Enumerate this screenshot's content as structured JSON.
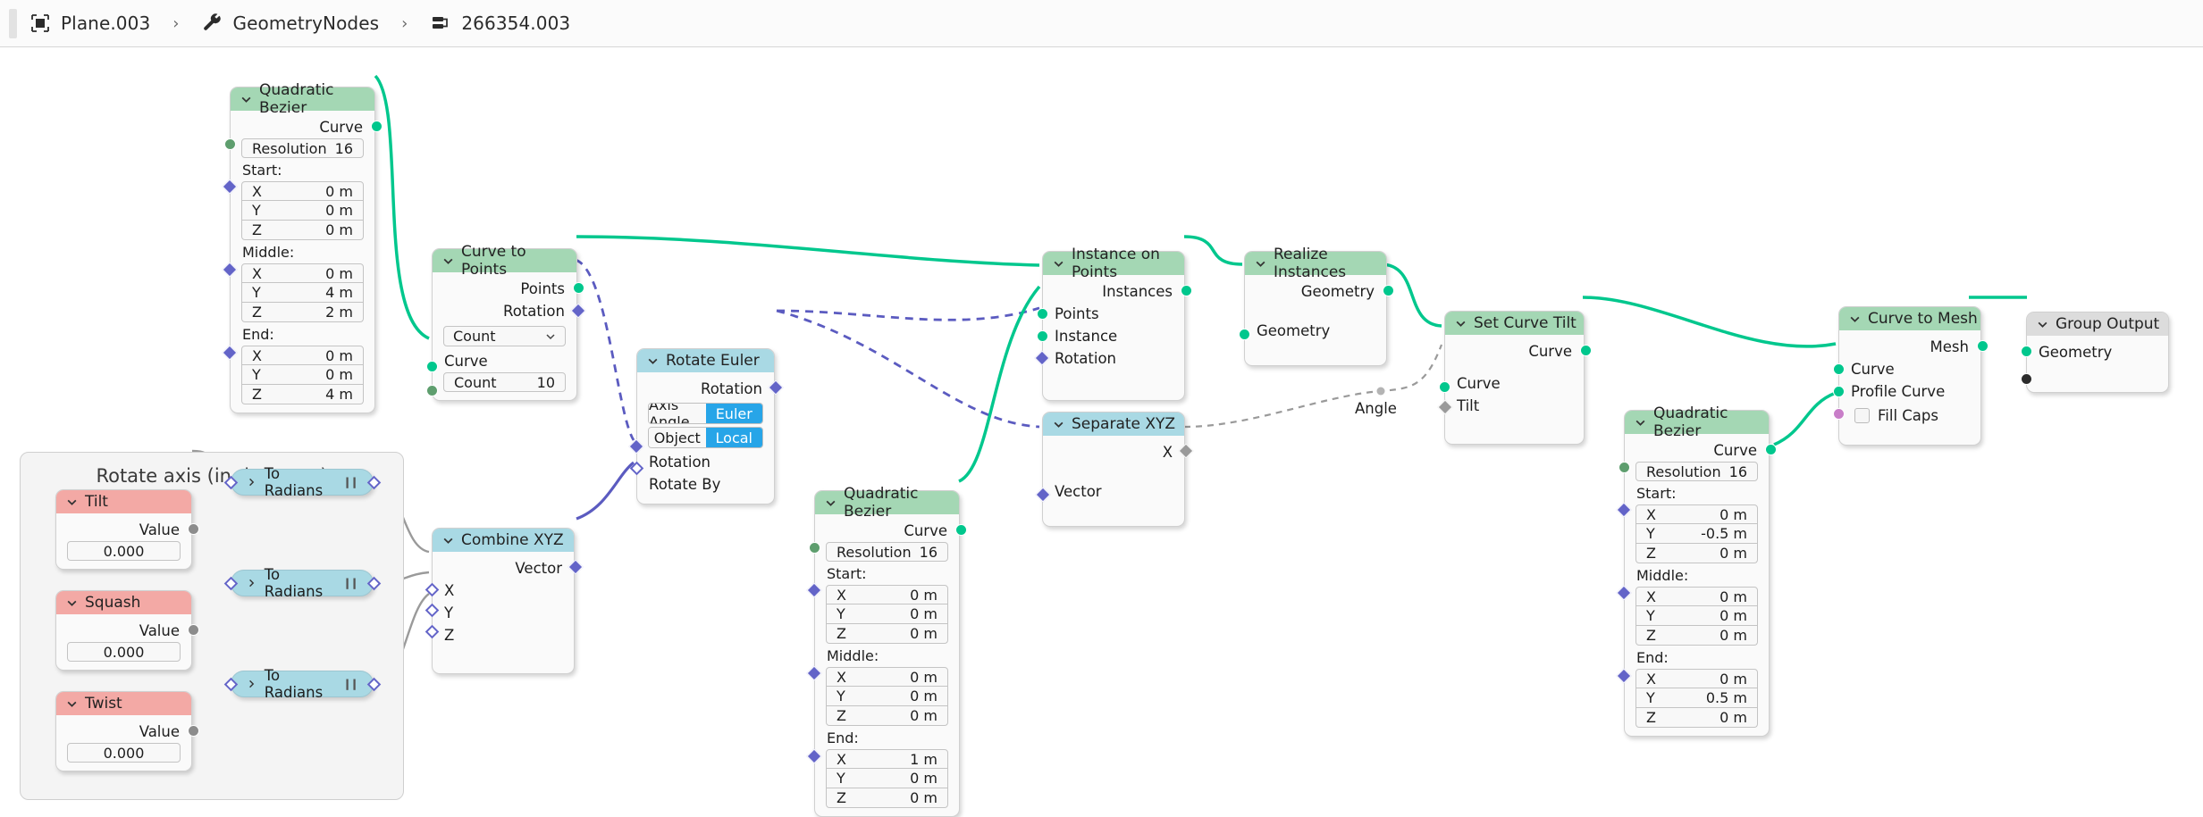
{
  "breadcrumb": {
    "object_icon": "object-icon",
    "object": "Plane.003",
    "modifier_icon": "wrench-icon",
    "modifier": "GeometryNodes",
    "nodetree_icon": "nodetree-icon",
    "nodetree": "266354.003",
    "separator": "›"
  },
  "frame": {
    "label": "Rotate axis (in dregrees)"
  },
  "colors": {
    "geometry_header": "#a4d7b4",
    "vector_header": "#a9d9e4",
    "input_header": "#f3a9a5",
    "output_header": "#dcdcdc",
    "toggle_active": "#27a5e8",
    "geometry_socket": "#00c78d",
    "vector_socket": "#6364c8",
    "wire_geometry": "#00c78d",
    "wire_vector": "#5b5bc0",
    "wire_grey": "#9a9a9a"
  },
  "nodes": {
    "bezier_left": {
      "title": "Quadratic Bezier",
      "out_curve": "Curve",
      "resolution_label": "Resolution",
      "resolution_value": "16",
      "start_label": "Start:",
      "start": {
        "x_label": "X",
        "x": "0 m",
        "y_label": "Y",
        "y": "0 m",
        "z_label": "Z",
        "z": "0 m"
      },
      "middle_label": "Middle:",
      "middle": {
        "x_label": "X",
        "x": "0 m",
        "y_label": "Y",
        "y": "4 m",
        "z_label": "Z",
        "z": "2 m"
      },
      "end_label": "End:",
      "end": {
        "x_label": "X",
        "x": "0 m",
        "y_label": "Y",
        "y": "0 m",
        "z_label": "Z",
        "z": "4 m"
      }
    },
    "curve_to_points": {
      "title": "Curve to Points",
      "out_points": "Points",
      "out_rotation": "Rotation",
      "mode": "Count",
      "in_curve": "Curve",
      "count_label": "Count",
      "count_value": "10"
    },
    "rotate_euler": {
      "title": "Rotate Euler",
      "out_rotation": "Rotation",
      "type_axis_angle": "Axis Angle",
      "type_euler": "Euler",
      "space_object": "Object",
      "space_local": "Local",
      "in_rotation": "Rotation",
      "in_rotate_by": "Rotate By"
    },
    "tilt": {
      "title": "Tilt",
      "out_value": "Value",
      "value": "0.000"
    },
    "squash": {
      "title": "Squash",
      "out_value": "Value",
      "value": "0.000"
    },
    "twist": {
      "title": "Twist",
      "out_value": "Value",
      "value": "0.000"
    },
    "to_radians_1": {
      "title": "To Radians",
      "mute_icon": "pause-icon"
    },
    "to_radians_2": {
      "title": "To Radians",
      "mute_icon": "pause-icon"
    },
    "to_radians_3": {
      "title": "To Radians",
      "mute_icon": "pause-icon"
    },
    "combine_xyz": {
      "title": "Combine XYZ",
      "out_vector": "Vector",
      "in_x": "X",
      "in_y": "Y",
      "in_z": "Z"
    },
    "bezier_mid": {
      "title": "Quadratic Bezier",
      "out_curve": "Curve",
      "resolution_label": "Resolution",
      "resolution_value": "16",
      "start_label": "Start:",
      "start": {
        "x_label": "X",
        "x": "0 m",
        "y_label": "Y",
        "y": "0 m",
        "z_label": "Z",
        "z": "0 m"
      },
      "middle_label": "Middle:",
      "middle": {
        "x_label": "X",
        "x": "0 m",
        "y_label": "Y",
        "y": "0 m",
        "z_label": "Z",
        "z": "0 m"
      },
      "end_label": "End:",
      "end": {
        "x_label": "X",
        "x": "1 m",
        "y_label": "Y",
        "y": "0 m",
        "z_label": "Z",
        "z": "0 m"
      }
    },
    "instance_on_points": {
      "title": "Instance on Points",
      "out_instances": "Instances",
      "in_points": "Points",
      "in_instance": "Instance",
      "in_rotation": "Rotation"
    },
    "separate_xyz": {
      "title": "Separate XYZ",
      "out_x": "X",
      "in_vector": "Vector"
    },
    "realize_instances": {
      "title": "Realize Instances",
      "out_geometry": "Geometry",
      "in_geometry": "Geometry"
    },
    "set_curve_tilt": {
      "title": "Set Curve Tilt",
      "out_curve": "Curve",
      "in_curve": "Curve",
      "in_tilt": "Tilt"
    },
    "bezier_right": {
      "title": "Quadratic Bezier",
      "out_curve": "Curve",
      "resolution_label": "Resolution",
      "resolution_value": "16",
      "start_label": "Start:",
      "start": {
        "x_label": "X",
        "x": "0 m",
        "y_label": "Y",
        "y": "-0.5 m",
        "z_label": "Z",
        "z": "0 m"
      },
      "middle_label": "Middle:",
      "middle": {
        "x_label": "X",
        "x": "0 m",
        "y_label": "Y",
        "y": "0 m",
        "z_label": "Z",
        "z": "0 m"
      },
      "end_label": "End:",
      "end": {
        "x_label": "X",
        "x": "0 m",
        "y_label": "Y",
        "y": "0.5 m",
        "z_label": "Z",
        "z": "0 m"
      }
    },
    "curve_to_mesh": {
      "title": "Curve to Mesh",
      "out_mesh": "Mesh",
      "in_curve": "Curve",
      "in_profile_curve": "Profile Curve",
      "in_fill_caps": "Fill Caps",
      "fill_caps_checked": false
    },
    "group_output": {
      "title": "Group Output",
      "in_geometry": "Geometry"
    }
  },
  "wire_labels": {
    "angle": "Angle"
  }
}
